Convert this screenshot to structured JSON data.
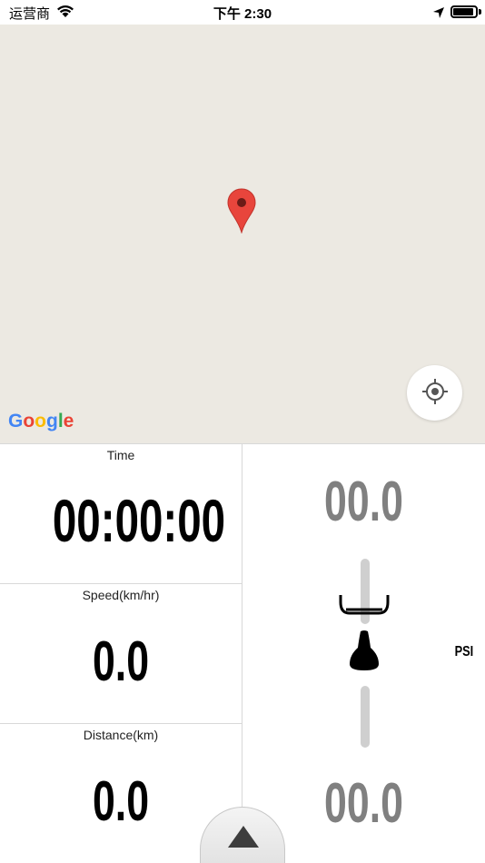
{
  "status_bar": {
    "carrier": "运营商",
    "time": "下午 2:30"
  },
  "map": {
    "provider_logo": "Google",
    "pin_color": "#e8453c",
    "background_color": "#ece9e2"
  },
  "metrics": {
    "time_label": "Time",
    "time_value": "00:00:00",
    "speed_label": "Speed(km/hr)",
    "speed_value": "0.0",
    "distance_label": "Distance(km)",
    "distance_value": "0.0"
  },
  "pressure": {
    "front_value": "00.0",
    "rear_value": "00.0",
    "unit": "PSI"
  },
  "icons": [
    "wifi-icon",
    "location-arrow-icon",
    "battery-icon",
    "map-pin-icon",
    "locate-me-icon",
    "handlebar-icon",
    "saddle-icon",
    "arrow-up-icon"
  ]
}
